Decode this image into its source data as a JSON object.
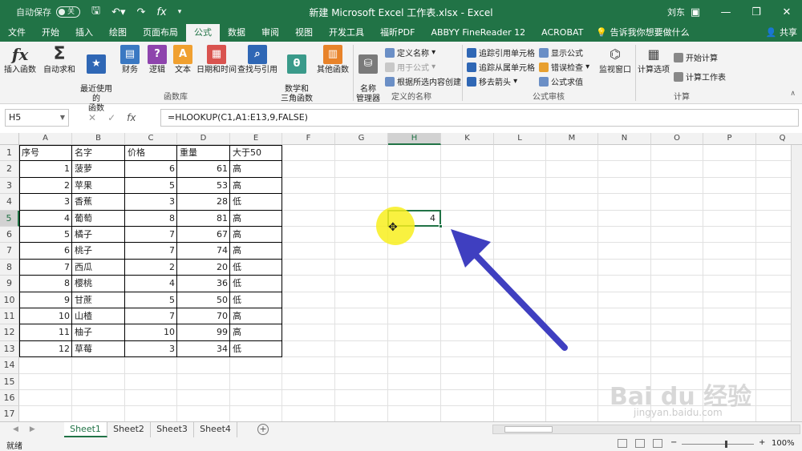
{
  "titlebar": {
    "autosave_label": "自动保存",
    "autosave_state": "关",
    "title": "新建 Microsoft Excel 工作表.xlsx  -  Excel",
    "user": "刘东"
  },
  "tabs": [
    "文件",
    "开始",
    "插入",
    "绘图",
    "页面布局",
    "公式",
    "数据",
    "审阅",
    "视图",
    "开发工具",
    "福昕PDF",
    "ABBYY FineReader 12",
    "ACROBAT"
  ],
  "active_tab": "公式",
  "tell_me": "告诉我你想要做什么",
  "share": "共享",
  "ribbon": {
    "insert_function": "插入函数",
    "autosum": "自动求和",
    "recent": "最近使用的\n函数",
    "financial": "财务",
    "logical": "逻辑",
    "text": "文本",
    "datetime": "日期和时间",
    "lookup": "查找与引用",
    "math": "数学和\n三角函数",
    "more": "其他函数",
    "group_library": "函数库",
    "name_manager": "名称\n管理器",
    "define_name": "定义名称",
    "use_in_formula": "用于公式",
    "create_from_selection": "根据所选内容创建",
    "group_names": "定义的名称",
    "trace_precedents": "追踪引用单元格",
    "trace_dependents": "追踪从属单元格",
    "remove_arrows": "移去箭头",
    "show_formulas": "显示公式",
    "error_checking": "错误检查",
    "evaluate_formula": "公式求值",
    "group_auditing": "公式审核",
    "watch_window": "监视窗口",
    "calc_options": "计算选项",
    "calc_now": "开始计算",
    "calc_sheet": "计算工作表",
    "group_calc": "计算"
  },
  "formula_bar": {
    "name_box": "H5",
    "formula": "=HLOOKUP(C1,A1:E13,9,FALSE)"
  },
  "columns": [
    "A",
    "B",
    "C",
    "D",
    "E",
    "F",
    "G",
    "H",
    "K",
    "L",
    "M",
    "N",
    "O",
    "P",
    "Q"
  ],
  "rows": [
    "1",
    "2",
    "3",
    "4",
    "5",
    "6",
    "7",
    "8",
    "9",
    "10",
    "11",
    "12",
    "13",
    "14",
    "15",
    "16",
    "17"
  ],
  "table": {
    "headers": [
      "序号",
      "名字",
      "价格",
      "重量",
      "大于50"
    ],
    "rows": [
      [
        "1",
        "菠萝",
        "6",
        "61",
        "高"
      ],
      [
        "2",
        "苹果",
        "5",
        "53",
        "高"
      ],
      [
        "3",
        "香蕉",
        "3",
        "28",
        "低"
      ],
      [
        "4",
        "葡萄",
        "8",
        "81",
        "高"
      ],
      [
        "5",
        "橘子",
        "7",
        "67",
        "高"
      ],
      [
        "6",
        "桃子",
        "7",
        "74",
        "高"
      ],
      [
        "7",
        "西瓜",
        "2",
        "20",
        "低"
      ],
      [
        "8",
        "樱桃",
        "4",
        "36",
        "低"
      ],
      [
        "9",
        "甘蔗",
        "5",
        "50",
        "低"
      ],
      [
        "10",
        "山楂",
        "7",
        "70",
        "高"
      ],
      [
        "11",
        "柚子",
        "10",
        "99",
        "高"
      ],
      [
        "12",
        "草莓",
        "3",
        "34",
        "低"
      ]
    ]
  },
  "active_cell": {
    "ref": "H5",
    "value": "4"
  },
  "sheets": [
    "Sheet1",
    "Sheet2",
    "Sheet3",
    "Sheet4"
  ],
  "active_sheet": "Sheet1",
  "status": {
    "ready": "就绪",
    "zoom": "100%"
  },
  "watermark": {
    "main": "Bai du 经验",
    "sub": "jingyan.baidu.com"
  },
  "colors": {
    "excel_green": "#217346",
    "arrow": "#3f3fc0",
    "highlight": "#f8ee1e"
  }
}
